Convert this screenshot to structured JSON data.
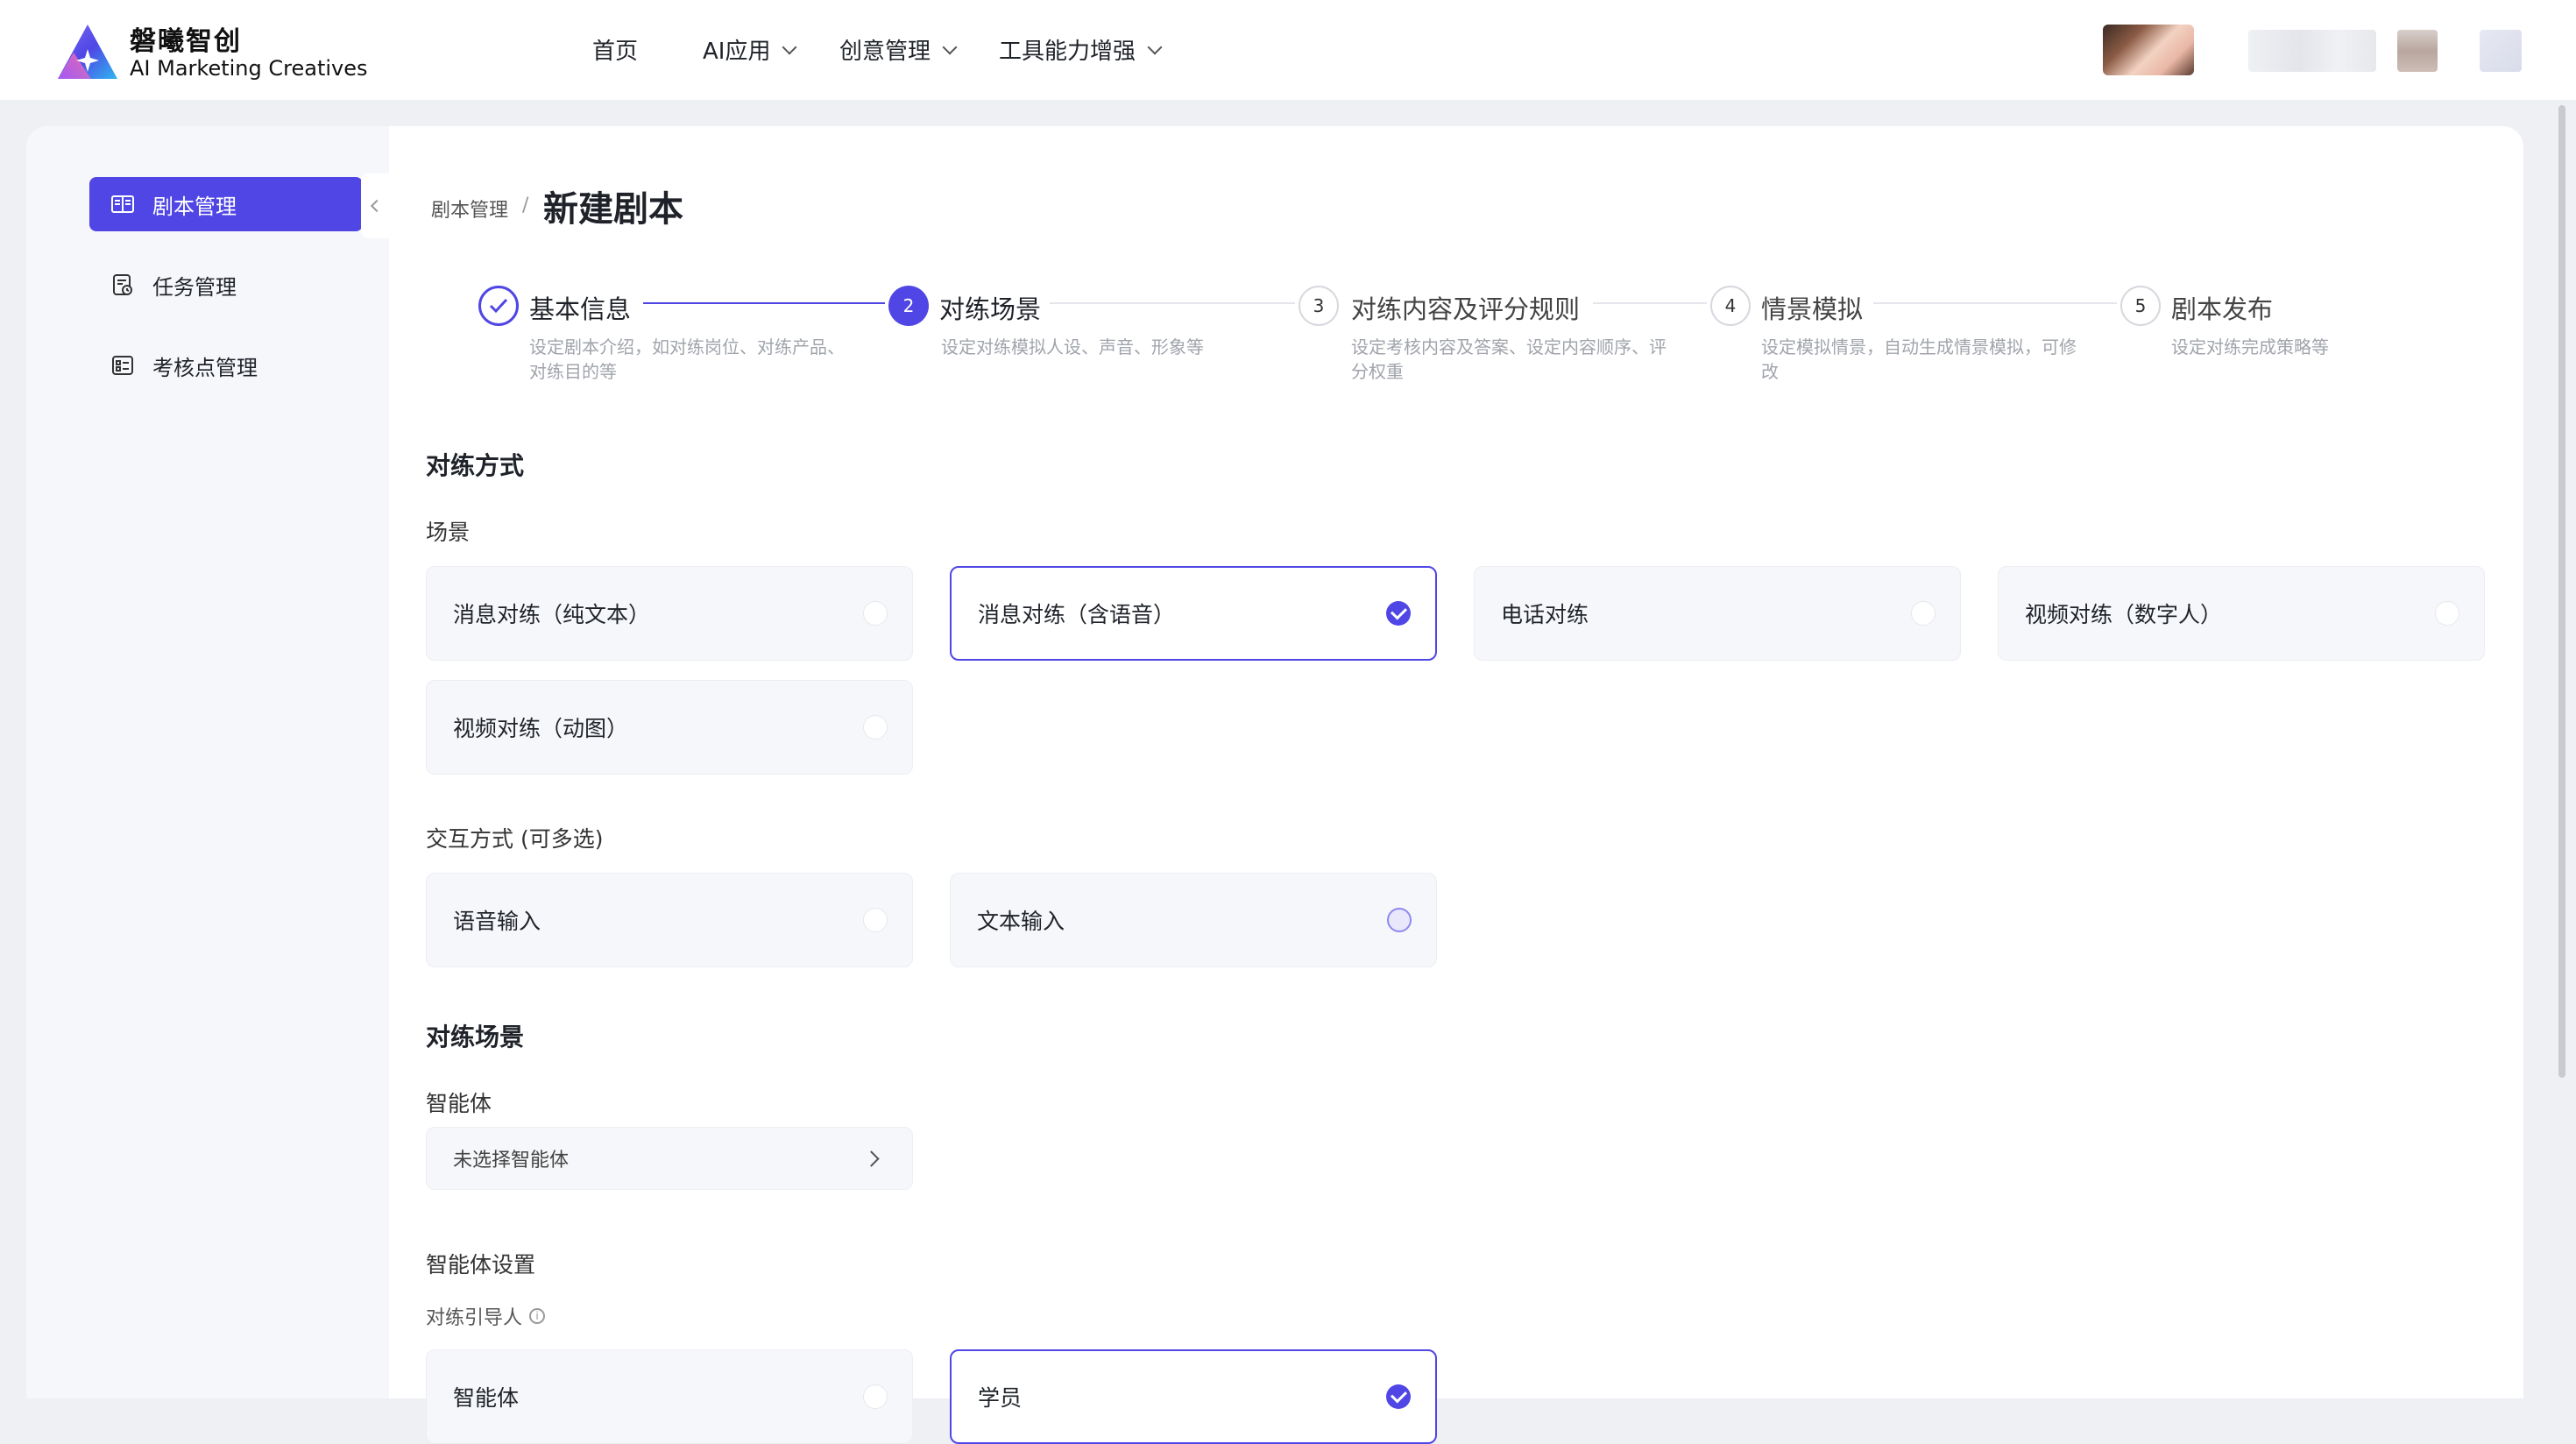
{
  "header": {
    "brand_name": "磐曦智创",
    "brand_sub": "AI Marketing Creatives",
    "nav": [
      {
        "label": "首页",
        "has_dropdown": false
      },
      {
        "label": "AI应用",
        "has_dropdown": true
      },
      {
        "label": "创意管理",
        "has_dropdown": true
      },
      {
        "label": "工具能力增强",
        "has_dropdown": true
      }
    ]
  },
  "sidebar": {
    "items": [
      {
        "label": "剧本管理",
        "icon": "book-icon",
        "active": true
      },
      {
        "label": "任务管理",
        "icon": "task-icon",
        "active": false
      },
      {
        "label": "考核点管理",
        "icon": "checklist-icon",
        "active": false
      }
    ]
  },
  "breadcrumb": {
    "parent": "剧本管理",
    "separator": "/"
  },
  "page_title": "新建剧本",
  "steps": [
    {
      "number": "",
      "title": "基本信息",
      "desc": "设定剧本介绍，如对练岗位、对练产品、对练目的等",
      "status": "done"
    },
    {
      "number": "2",
      "title": "对练场景",
      "desc": "设定对练模拟人设、声音、形象等",
      "status": "active"
    },
    {
      "number": "3",
      "title": "对练内容及评分规则",
      "desc": "设定考核内容及答案、设定内容顺序、评分权重",
      "status": "todo"
    },
    {
      "number": "4",
      "title": "情景模拟",
      "desc": "设定模拟情景，自动生成情景模拟，可修改",
      "status": "todo"
    },
    {
      "number": "5",
      "title": "剧本发布",
      "desc": "设定对练完成策略等",
      "status": "todo"
    }
  ],
  "practice_mode": {
    "title": "对练方式",
    "scene_label": "场景",
    "scenes": [
      {
        "label": "消息对练（纯文本）",
        "selected": false
      },
      {
        "label": "消息对练（含语音）",
        "selected": true
      },
      {
        "label": "电话对练",
        "selected": false
      },
      {
        "label": "视频对练（数字人）",
        "selected": false
      },
      {
        "label": "视频对练（动图）",
        "selected": false
      }
    ],
    "interaction_label": "交互方式 (可多选)",
    "interactions": [
      {
        "label": "语音输入",
        "state": "unchecked"
      },
      {
        "label": "文本输入",
        "state": "partial"
      }
    ]
  },
  "practice_scene": {
    "title": "对练场景",
    "agent_label": "智能体",
    "agent_placeholder": "未选择智能体",
    "agent_settings_title": "智能体设置",
    "guide_label": "对练引导人",
    "guides": [
      {
        "label": "智能体",
        "selected": false
      },
      {
        "label": "学员",
        "selected": true
      }
    ]
  },
  "colors": {
    "accent": "#4f46e5",
    "background": "#eef0f4",
    "card": "#f6f7fa"
  }
}
